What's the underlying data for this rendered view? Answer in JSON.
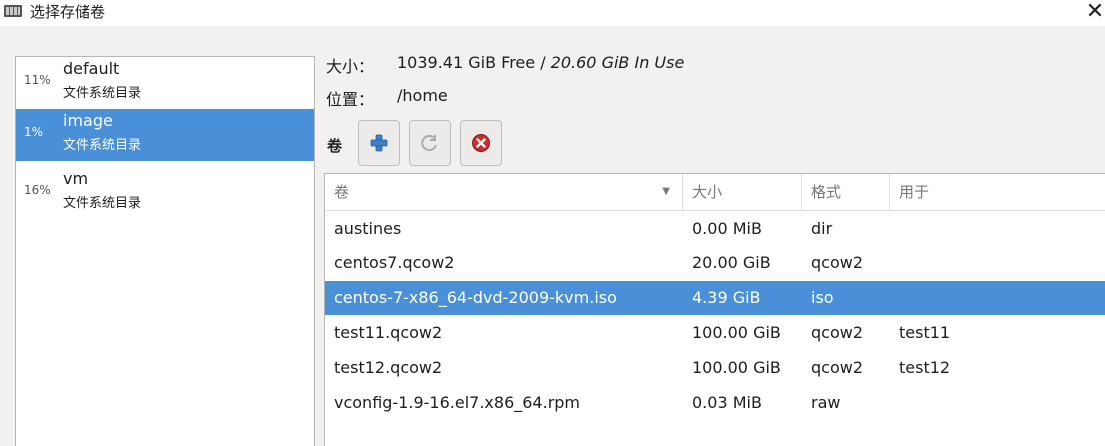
{
  "window": {
    "title": "选择存储卷",
    "icon": "storage-app-icon",
    "close_glyph": "✕"
  },
  "pools": [
    {
      "percent": "11%",
      "name": "default",
      "type": "文件系统目录",
      "selected": false
    },
    {
      "percent": "1%",
      "name": "image",
      "type": "文件系统目录",
      "selected": true
    },
    {
      "percent": "16%",
      "name": "vm",
      "type": "文件系统目录",
      "selected": false
    }
  ],
  "details": {
    "size_label": "大小：",
    "size_free": "1039.41 GiB Free / ",
    "size_in_use": "20.60 GiB In Use",
    "location_label": "位置：",
    "location_value": "/home"
  },
  "volumes_toolbar": {
    "label": "卷",
    "buttons": [
      {
        "name": "add-volume",
        "icon": "plus-icon"
      },
      {
        "name": "refresh-volumes",
        "icon": "refresh-icon"
      },
      {
        "name": "delete-volume",
        "icon": "delete-icon"
      }
    ]
  },
  "volume_table": {
    "columns": [
      "卷",
      "大小",
      "格式",
      "用于"
    ],
    "sort_indicator": "▼",
    "rows": [
      {
        "name": "austines",
        "size": "0.00 MiB",
        "format": "dir",
        "used_by": "",
        "selected": false
      },
      {
        "name": "centos7.qcow2",
        "size": "20.00 GiB",
        "format": "qcow2",
        "used_by": "",
        "selected": false
      },
      {
        "name": "centos-7-x86_64-dvd-2009-kvm.iso",
        "size": "4.39 GiB",
        "format": "iso",
        "used_by": "",
        "selected": true
      },
      {
        "name": "test11.qcow2",
        "size": "100.00 GiB",
        "format": "qcow2",
        "used_by": "test11",
        "selected": false
      },
      {
        "name": "test12.qcow2",
        "size": "100.00 GiB",
        "format": "qcow2",
        "used_by": "test12",
        "selected": false
      },
      {
        "name": "vconfig-1.9-16.el7.x86_64.rpm",
        "size": "0.03 MiB",
        "format": "raw",
        "used_by": "",
        "selected": false
      }
    ]
  },
  "colors": {
    "selection": "#4a90d9",
    "background": "#f2f1f0",
    "add_icon": "#3c7fc8",
    "delete_icon": "#d02b2b"
  }
}
